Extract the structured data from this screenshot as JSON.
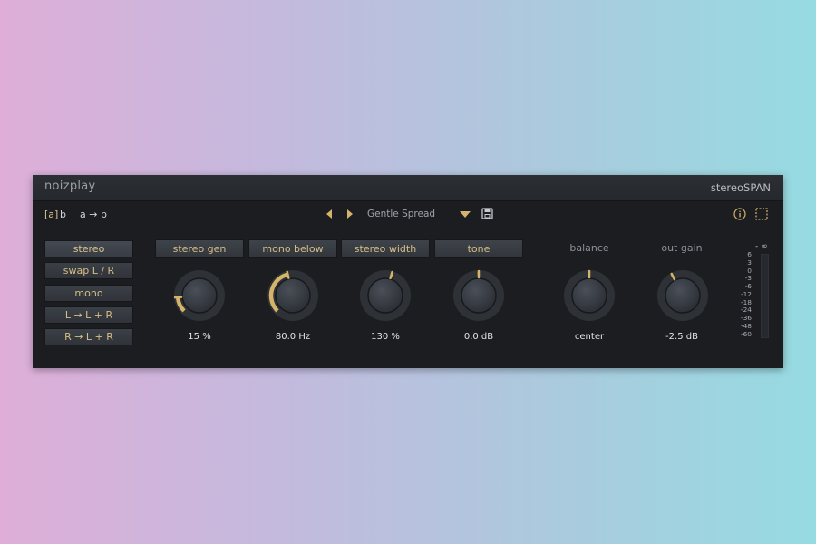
{
  "header": {
    "brand": "noizplay",
    "product": "stereoSPAN"
  },
  "toolbar": {
    "ab_a": "[a]",
    "ab_b": "b",
    "ab_copy": "a → b",
    "preset_name": "Gentle Spread",
    "icons": {
      "prev": "triangle-left-icon",
      "next": "triangle-right-icon",
      "dropdown": "triangle-down-icon",
      "save": "save-icon",
      "info": "info-icon",
      "resize": "resize-icon"
    }
  },
  "modes": {
    "items": [
      {
        "label": "stereo",
        "active": true
      },
      {
        "label": "swap L / R",
        "active": false
      },
      {
        "label": "mono",
        "active": false
      },
      {
        "label": "L → L + R",
        "active": false
      },
      {
        "label": "R → L + R",
        "active": false
      }
    ]
  },
  "params": {
    "stereo_gen": {
      "label": "stereo gen",
      "value": "15 %",
      "knob_level": 0.15
    },
    "mono_below": {
      "label": "mono below",
      "value": "80.0 Hz",
      "knob_level": 0.45
    },
    "stereo_width": {
      "label": "stereo width",
      "value": "130 %",
      "knob_level": 0.56
    },
    "tone": {
      "label": "tone",
      "value": "0.0 dB",
      "knob_level": 0.5
    },
    "balance": {
      "label": "balance",
      "value": "center",
      "knob_level": 0.5
    },
    "out_gain": {
      "label": "out gain",
      "value": "-2.5 dB",
      "knob_level": 0.4
    }
  },
  "meter": {
    "top_label": "- ∞",
    "scale": [
      "6",
      "3",
      "0",
      "-3",
      "-6",
      "-12",
      "-18",
      "-24",
      "-36",
      "-48",
      "-60"
    ]
  },
  "colors": {
    "accent": "#d4b36a",
    "panel": "#1b1d20",
    "knob_track": "#2e3136",
    "knob_body": "#3a3e46"
  }
}
